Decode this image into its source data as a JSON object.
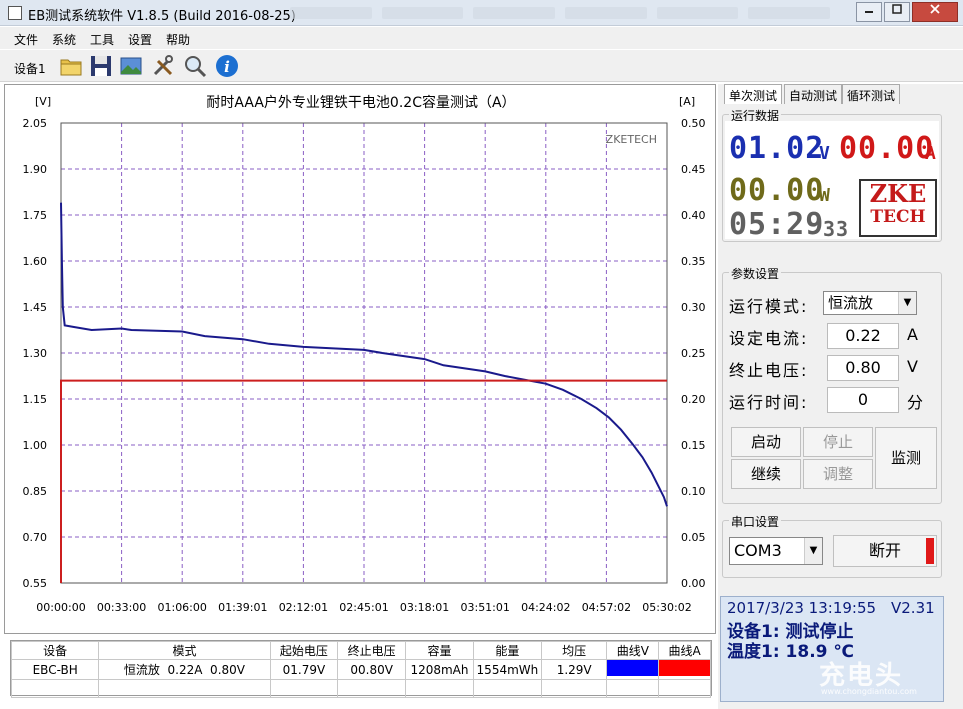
{
  "window": {
    "title": "EB测试系统软件 V1.8.5 (Build 2016-08-25)",
    "min_label": "0",
    "max_label": "1",
    "close_label": "r"
  },
  "menu": [
    "文件",
    "系统",
    "工具",
    "设置",
    "帮助"
  ],
  "toolbar": {
    "device_tab": "设备1",
    "icons": [
      "folder-icon",
      "save-icon",
      "image-icon",
      "tools-icon",
      "zoom-icon",
      "info-icon"
    ]
  },
  "chart": {
    "title": "耐时AAA户外专业锂铁干电池0.2C容量测试（A）",
    "left_unit": "[V]",
    "right_unit": "[A]",
    "watermark": "ZKETECH"
  },
  "chart_data": {
    "type": "line",
    "title": "耐时AAA户外专业锂铁干电池0.2C容量测试（A）",
    "xlabel": "",
    "ylabel": "[V]",
    "y2label": "[A]",
    "xlim": [
      0,
      19802
    ],
    "ylim": [
      0.55,
      2.05
    ],
    "y2lim": [
      0.0,
      0.5
    ],
    "grid": true,
    "x_ticks": [
      "00:00:00",
      "00:33:00",
      "01:06:00",
      "01:39:01",
      "02:12:01",
      "02:45:01",
      "03:18:01",
      "03:51:01",
      "04:24:02",
      "04:57:02",
      "05:30:02"
    ],
    "y_ticks": [
      "2.05",
      "1.90",
      "1.75",
      "1.60",
      "1.45",
      "1.30",
      "1.15",
      "1.00",
      "0.85",
      "0.70",
      "0.55"
    ],
    "y2_ticks": [
      "0.50",
      "0.45",
      "0.40",
      "0.35",
      "0.30",
      "0.25",
      "0.20",
      "0.15",
      "0.10",
      "0.05",
      "0.00"
    ],
    "series": [
      {
        "name": "曲线V",
        "axis": "left",
        "color": "#1a1a8c",
        "x": [
          0,
          30,
          60,
          120,
          400,
          1000,
          1980,
          2300,
          3960,
          4700,
          5940,
          6800,
          7920,
          8900,
          9900,
          10500,
          11880,
          12500,
          13860,
          14500,
          15840,
          16400,
          17000,
          17500,
          17900,
          18300,
          18700,
          19000,
          19300,
          19500,
          19700,
          19802
        ],
        "y": [
          1.79,
          1.6,
          1.45,
          1.39,
          1.385,
          1.375,
          1.38,
          1.375,
          1.37,
          1.355,
          1.345,
          1.33,
          1.32,
          1.315,
          1.31,
          1.3,
          1.28,
          1.26,
          1.24,
          1.225,
          1.2,
          1.18,
          1.15,
          1.12,
          1.09,
          1.05,
          1.0,
          0.96,
          0.91,
          0.87,
          0.83,
          0.8
        ]
      },
      {
        "name": "曲线A",
        "axis": "right",
        "color": "#cc1f1f",
        "x": [
          0,
          1,
          19802
        ],
        "y": [
          0.0,
          0.22,
          0.22
        ]
      }
    ]
  },
  "table": {
    "headers": [
      "设备",
      "模式",
      "起始电压",
      "终止电压",
      "容量",
      "能量",
      "均压",
      "曲线V",
      "曲线A"
    ],
    "row": [
      "EBC-BH",
      "恒流放  0.22A  0.80V",
      "01.79V",
      "00.80V",
      "1208mAh",
      "1554mWh",
      "1.29V",
      "",
      ""
    ],
    "curve_v_color": "#0000ff",
    "curve_a_color": "#ff0000"
  },
  "tabs": [
    "单次测试",
    "自动测试",
    "循环测试"
  ],
  "run_data": {
    "title": "运行数据",
    "voltage": "01.02",
    "voltage_unit": "V",
    "current": "00.00",
    "current_unit": "A",
    "power": "00.00",
    "power_unit": "W",
    "time": "05:29",
    "seconds": "33",
    "logo_line1": "ZKE",
    "logo_line2": "TECH",
    "voltage_color": "#1a2fb0",
    "current_color": "#d01818",
    "power_color": "#6f6a1a",
    "time_color": "#606060"
  },
  "params": {
    "title": "参数设置",
    "mode_label": "运行模式:",
    "mode_value": "恒流放",
    "current_label": "设定电流:",
    "current_value": "0.22",
    "current_unit": "A",
    "cutoff_label": "终止电压:",
    "cutoff_value": "0.80",
    "cutoff_unit": "V",
    "time_label": "运行时间:",
    "time_value": "0",
    "time_unit": "分"
  },
  "buttons": {
    "start": "启动",
    "stop": "停止",
    "continue": "继续",
    "adjust": "调整",
    "monitor": "监测"
  },
  "serial": {
    "title": "串口设置",
    "port": "COM3",
    "disconnect": "断开"
  },
  "status": {
    "datetime": "2017/3/23 13:19:55",
    "version": "V2.31",
    "device_status": "设备1: 测试停止",
    "temperature": "温度1: 18.9 ℃"
  },
  "watermark_site": {
    "logo": "充电头",
    "url": "www.chongdiantou.com"
  }
}
